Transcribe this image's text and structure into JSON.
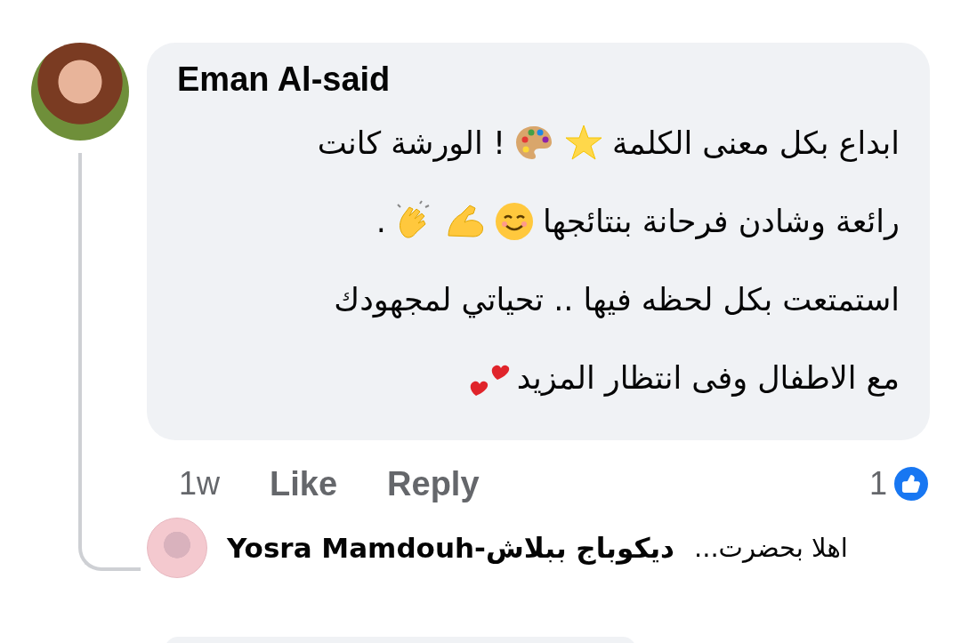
{
  "comment": {
    "author": "Eman Al-said",
    "lines": [
      {
        "segments": [
          {
            "kind": "text",
            "text": "ابداع بكل معنى الكلمة"
          },
          {
            "kind": "star"
          },
          {
            "kind": "palette"
          },
          {
            "kind": "text",
            "text": "! الورشة كانت"
          }
        ]
      },
      {
        "segments": [
          {
            "kind": "text",
            "text": "رائعة وشادن فرحانة بنتائجها"
          },
          {
            "kind": "smile"
          },
          {
            "kind": "muscle"
          },
          {
            "kind": "clap"
          },
          {
            "kind": "text",
            "text": "."
          }
        ]
      },
      {
        "segments": [
          {
            "kind": "text",
            "text": "استمتعت بكل لحظه فيها .. تحياتي لمجهودك"
          }
        ]
      },
      {
        "segments": [
          {
            "kind": "text",
            "text": "مع الاطفال وفى انتظار المزيد"
          },
          {
            "kind": "hearts"
          }
        ]
      }
    ],
    "time": "1w",
    "like_label": "Like",
    "reply_label": "Reply",
    "reaction_count": "1"
  },
  "reply": {
    "author": "Yosra Mamdouh-ديكوباج ببلاش",
    "text": "اهلا بحضرت..."
  }
}
